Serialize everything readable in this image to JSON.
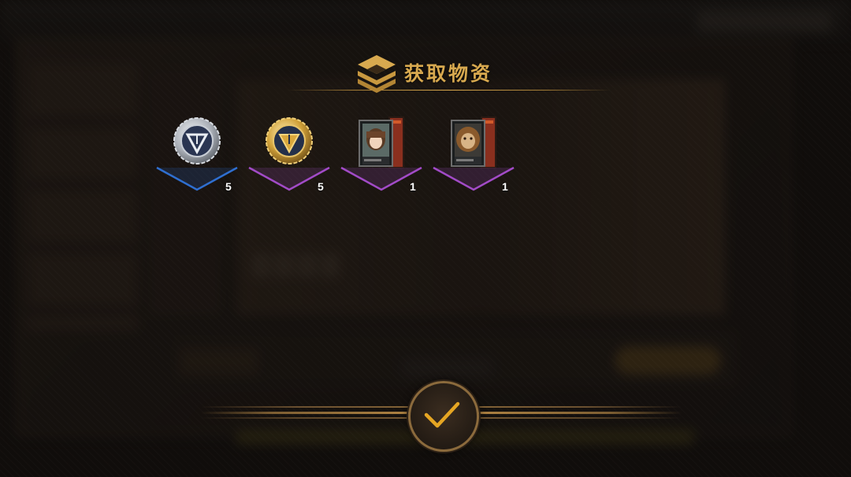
{
  "dialog": {
    "title": "获取物资"
  },
  "rewards": [
    {
      "icon": "silver-medal-icon",
      "count": "5",
      "rarity_color": "#2f6fd0"
    },
    {
      "icon": "gold-medal-icon",
      "count": "5",
      "rarity_color": "#a24bc7"
    },
    {
      "icon": "operator-token-girl-icon",
      "count": "1",
      "rarity_color": "#a24bc7"
    },
    {
      "icon": "operator-token-lion-icon",
      "count": "1",
      "rarity_color": "#a24bc7"
    }
  ],
  "confirm": {
    "icon": "check-icon",
    "color": "#e6a623"
  }
}
